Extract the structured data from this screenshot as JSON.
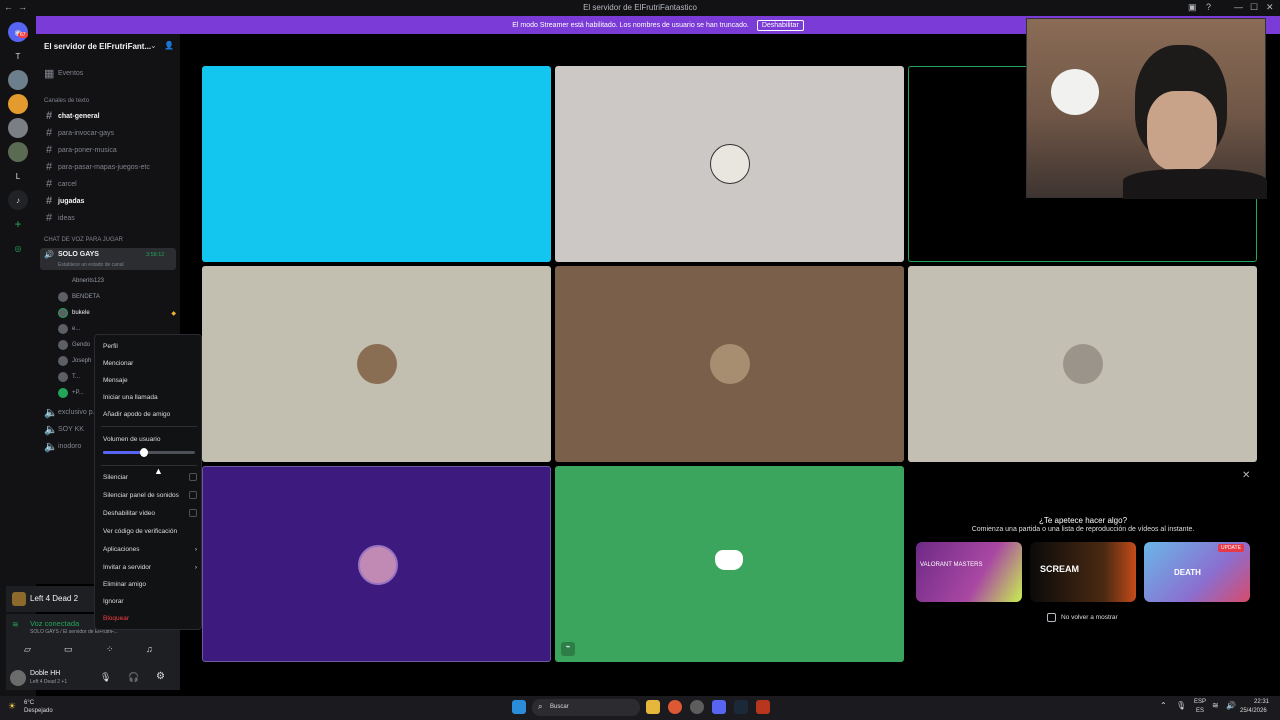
{
  "window": {
    "title": "El servidor de ElFrutriFantastico",
    "minimize": "—",
    "maximize": "☐",
    "close": "✕"
  },
  "banner": {
    "text": "El modo Streamer está habilitado. Los nombres de usuario se han truncado.",
    "button": "Deshabilitar"
  },
  "rail": {
    "home_badge": "67",
    "letters": [
      "T",
      "L"
    ]
  },
  "server": {
    "name": "El servidor de ElFrutriFant...",
    "events": "Eventos"
  },
  "text_category": "Canales de texto",
  "text_channels": [
    {
      "name": "chat-general",
      "bold": true
    },
    {
      "name": "para-invocar-gays",
      "bold": false
    },
    {
      "name": "para-poner-musica",
      "bold": false
    },
    {
      "name": "para-pasar-mapas-juegos-etc",
      "bold": false
    },
    {
      "name": "carcel",
      "bold": false
    },
    {
      "name": "jugadas",
      "bold": true
    },
    {
      "name": "ideas",
      "bold": false
    }
  ],
  "voice_category": "CHAT DE VOZ PARA JUGAR",
  "active_voice": {
    "name": "SOLO GAYS",
    "timer": "3:58:12",
    "status": "Establece un estado de canal"
  },
  "voice_users": [
    "Abnerits123",
    "BENDETA",
    "bukele",
    "e...",
    "Gendo",
    "Joseph",
    "T...",
    "+P..."
  ],
  "other_voice_channels": [
    "exclusivo p...",
    "SOY KK",
    "inodoro"
  ],
  "activity": {
    "game": "Left 4 Dead 2"
  },
  "voice_status": {
    "title": "Voz conectada",
    "sub": "SOLO GAYS / El servidor de ElFrutriF..."
  },
  "current_user": {
    "name": "Doble HH",
    "status": "Left 4 Dead 2 +1"
  },
  "context_menu": {
    "items_top": [
      "Perfil",
      "Mencionar",
      "Mensaje",
      "Iniciar una llamada",
      "Añadir apodo de amigo"
    ],
    "volume_label": "Volumen de usuario",
    "volume_level": 0.45,
    "checkbox_items": [
      "Silenciar",
      "Silenciar panel de sonidos",
      "Deshabilitar vídeo"
    ],
    "items_mid": [
      "Ver código de verificación"
    ],
    "submenu_items": [
      "Aplicaciones",
      "Invitar a servidor"
    ],
    "items_bottom": [
      "Eliminar amigo",
      "Ignorar"
    ],
    "danger_item": "Bloquear"
  },
  "tiles_colors": [
    "#12c6f0",
    "#cbc8c5",
    "#000000",
    "#c3bfb0",
    "#7a5f4a",
    "#c3bfb2",
    "#3d1a7e",
    "#3ba55d"
  ],
  "activity_card": {
    "title": "¿Te apetece hacer algo?",
    "subtitle": "Comienza una partida o una lista de reproducción de vídeos al instante.",
    "games": [
      "VALORANT MASTERS",
      "SCREAM",
      "DEATH"
    ],
    "update_badge": "UPDATE",
    "checkbox_label": "No volver a mostrar",
    "close": "✕"
  },
  "taskbar": {
    "weather_temp": "6°C",
    "weather_desc": "Despejado",
    "search": "Buscar",
    "lang": "ESP",
    "lang_sub": "ES",
    "time": "22:31",
    "date": "25/4/2026"
  }
}
